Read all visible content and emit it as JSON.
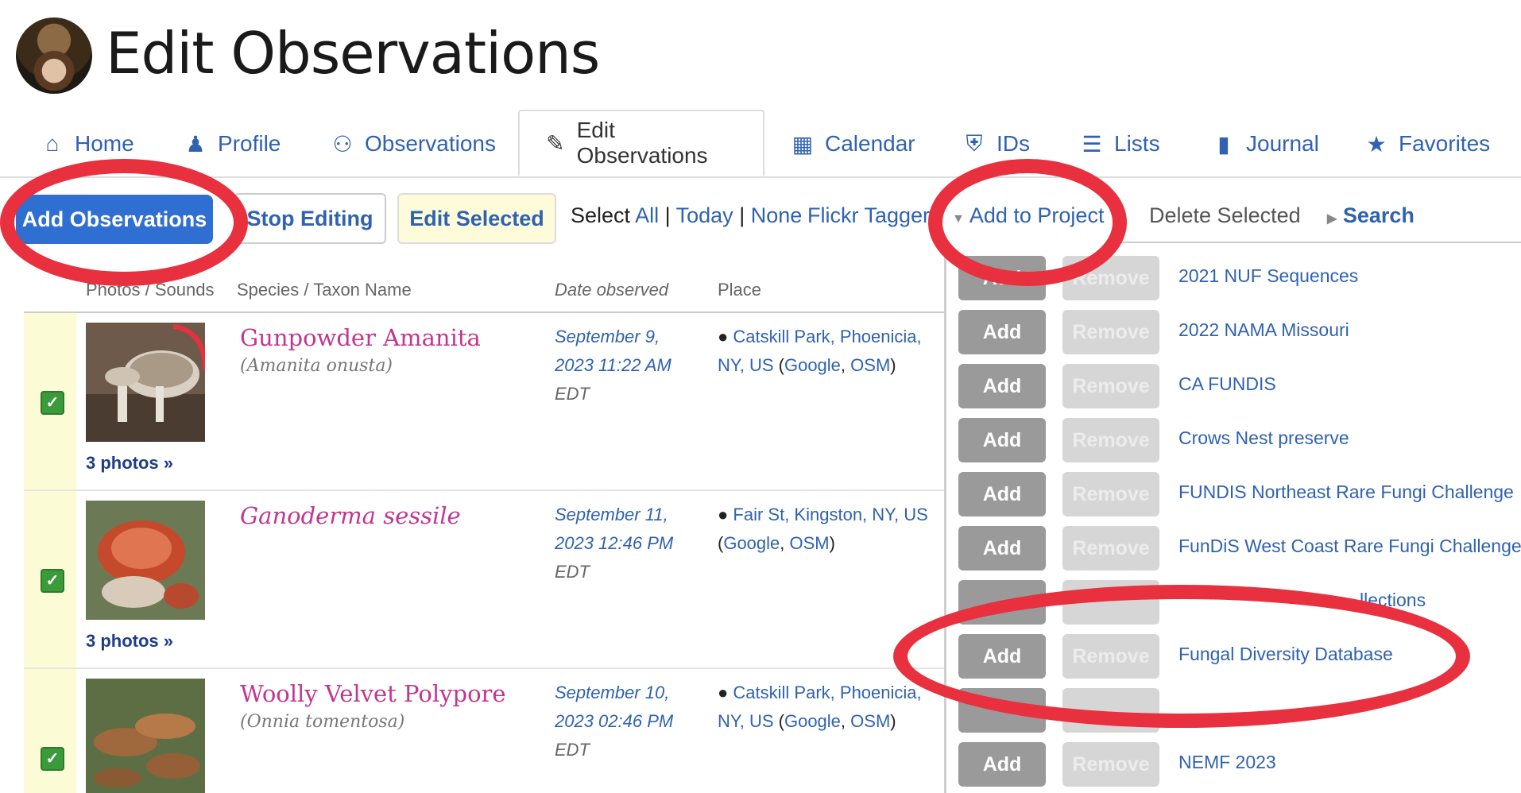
{
  "page": {
    "title": "Edit Observations"
  },
  "tabs": [
    {
      "label": "Home",
      "icon": "home-icon"
    },
    {
      "label": "Profile",
      "icon": "user-icon"
    },
    {
      "label": "Observations",
      "icon": "binoculars-icon"
    },
    {
      "label": "Edit Observations",
      "icon": "pencil-icon",
      "active": true
    },
    {
      "label": "Calendar",
      "icon": "calendar-icon"
    },
    {
      "label": "IDs",
      "icon": "badge-icon"
    },
    {
      "label": "Lists",
      "icon": "list-icon"
    },
    {
      "label": "Journal",
      "icon": "book-icon"
    },
    {
      "label": "Favorites",
      "icon": "star-icon"
    }
  ],
  "toolbar": {
    "add_observations": "Add Observations",
    "stop_editing": "Stop Editing",
    "edit_selected": "Edit Selected",
    "select_label": "Select",
    "select_all": "All",
    "select_today": "Today",
    "select_none": "None",
    "separator": "|",
    "flickr_tagger": "Flickr Tagger",
    "add_to_project": "Add to Project",
    "delete_selected": "Delete Selected",
    "search": "Search"
  },
  "table": {
    "headers": {
      "photos": "Photos / Sounds",
      "species": "Species / Taxon Name",
      "date": "Date observed",
      "place": "Place"
    },
    "rows": [
      {
        "common_name": "Gunpowder Amanita",
        "scientific_name": "(Amanita onusta)",
        "photos_link": "3 photos »",
        "date_line1": "September 9,",
        "date_line2": "2023 11:22 AM",
        "tz": "EDT",
        "place_line1": "Catskill Park, Phoenicia,",
        "place_line2": "NY, US",
        "place_google": "Google",
        "place_osm": "OSM",
        "checked": true
      },
      {
        "common_name": "Ganoderma sessile",
        "scientific_name": "",
        "photos_link": "3 photos »",
        "date_line1": "September 11,",
        "date_line2": "2023 12:46 PM",
        "tz": "EDT",
        "place_line1": "Fair St, Kingston, NY, US",
        "place_line2": "",
        "place_google": "Google",
        "place_osm": "OSM",
        "checked": true
      },
      {
        "common_name": "Woolly Velvet Polypore",
        "scientific_name": "(Onnia tomentosa)",
        "photos_link": "",
        "date_line1": "September 10,",
        "date_line2": "2023 02:46 PM",
        "tz": "EDT",
        "place_line1": "Catskill Park, Phoenicia,",
        "place_line2": "NY, US",
        "place_google": "Google",
        "place_osm": "OSM",
        "checked": true
      }
    ]
  },
  "project_dropdown": {
    "add_label": "Add",
    "remove_label": "Remove",
    "projects": [
      "2021 NUF Sequences",
      "2022 NAMA Missouri",
      "CA FUNDIS",
      "Crows Nest preserve",
      "FUNDIS Northeast Rare Fungi Challenge",
      "FunDiS West Coast Rare Fungi Challenge",
      "llections",
      "Fungal Diversity Database",
      "",
      "NEMF 2023"
    ]
  },
  "colors": {
    "link": "#2f62b0",
    "primary_button": "#2f6fd1",
    "species_name": "#c2368f",
    "annotation_red": "#e8303f",
    "row_highlight": "#fbfbd6"
  }
}
